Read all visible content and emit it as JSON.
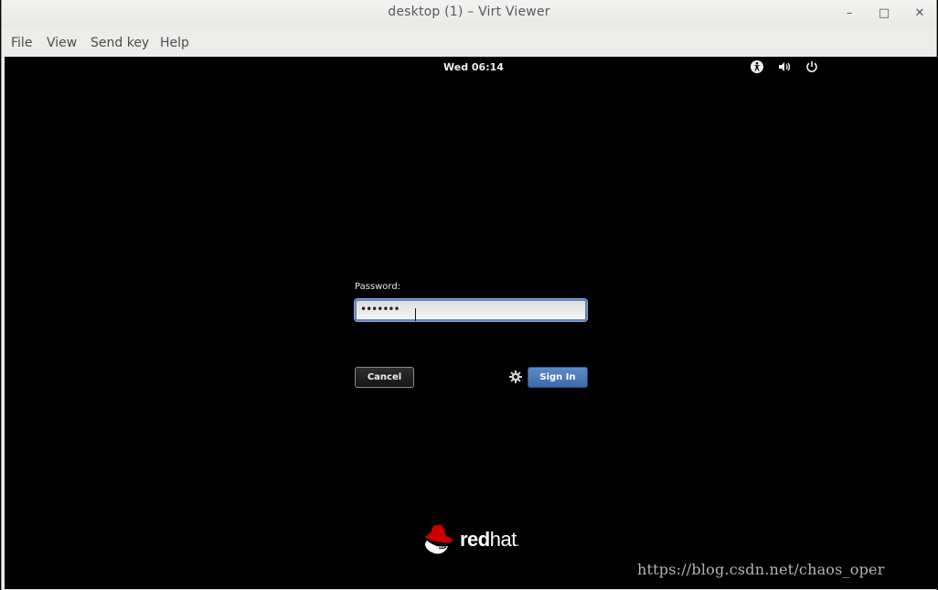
{
  "window": {
    "title": "desktop (1) – Virt Viewer",
    "controls": {
      "minimize": "–",
      "maximize": "□",
      "close": "✕"
    }
  },
  "menubar": {
    "items": [
      "File",
      "View",
      "Send key",
      "Help"
    ]
  },
  "guest": {
    "topbar": {
      "clock": "Wed 06:14",
      "icons": [
        "accessibility-icon",
        "volume-icon",
        "power-icon"
      ]
    },
    "login": {
      "password_label": "Password:",
      "password_value": "•••••••",
      "cancel_label": "Cancel",
      "signin_label": "Sign In"
    },
    "logo": {
      "brand_bold": "red",
      "brand_light": "hat",
      "trademark": "."
    }
  },
  "watermark": "https://blog.csdn.net/chaos_oper",
  "colors": {
    "accent": "#4a76b4",
    "focus_border": "#5f87bf",
    "logo_red": "#cc0000"
  }
}
